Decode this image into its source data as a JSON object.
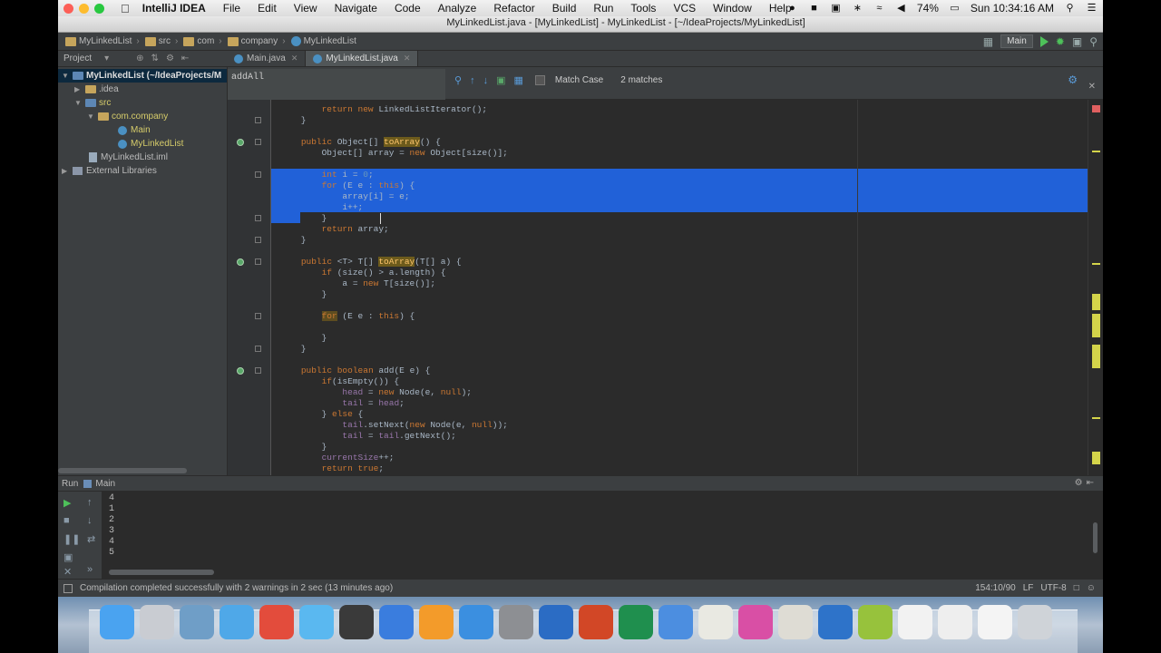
{
  "menubar": {
    "app_name": "IntelliJ IDEA",
    "items": [
      "File",
      "Edit",
      "View",
      "Navigate",
      "Code",
      "Analyze",
      "Refactor",
      "Build",
      "Run",
      "Tools",
      "VCS",
      "Window",
      "Help"
    ],
    "battery": "74%",
    "clock": "Sun 10:34:16 AM"
  },
  "window_title": "MyLinkedList.java - [MyLinkedList] - MyLinkedList - [~/IdeaProjects/MyLinkedList]",
  "breadcrumbs": [
    "MyLinkedList",
    "src",
    "com",
    "company",
    "MyLinkedList"
  ],
  "run_config": "Main",
  "project_panel": {
    "label": "Project",
    "tree": [
      {
        "label": "MyLinkedList (~/IdeaProjects/M",
        "level": 0
      },
      {
        "label": ".idea",
        "level": 1
      },
      {
        "label": "src",
        "level": 1
      },
      {
        "label": "com.company",
        "level": 2
      },
      {
        "label": "Main",
        "level": 3
      },
      {
        "label": "MyLinkedList",
        "level": 3
      },
      {
        "label": "MyLinkedList.iml",
        "level": 1
      },
      {
        "label": "External Libraries",
        "level": 0
      }
    ]
  },
  "tabs": [
    {
      "label": "Main.java",
      "active": false
    },
    {
      "label": "MyLinkedList.java",
      "active": true
    }
  ],
  "find": {
    "query": "addAll",
    "match_case_label": "Match Case",
    "matches": "2 matches"
  },
  "code": [
    "        return new LinkedListIterator();",
    "    }",
    "",
    "    public Object[] toArray() {",
    "        Object[] array = new Object[size()];",
    "",
    "        int i = 0;",
    "        for (E e : this) {",
    "            array[i] = e;",
    "            i++;",
    "        }",
    "        return array;",
    "    }",
    "",
    "    public <T> T[] toArray(T[] a) {",
    "        if (size() > a.length) {",
    "            a = new T[size()];",
    "        }",
    "",
    "        for (E e : this) {",
    "",
    "        }",
    "    }",
    "",
    "    public boolean add(E e) {",
    "        if(isEmpty()) {",
    "            head = new Node(e, null);",
    "            tail = head;",
    "        } else {",
    "            tail.setNext(new Node(e, null));",
    "            tail = tail.getNext();",
    "        }",
    "        currentSize++;",
    "        return true;"
  ],
  "run_panel": {
    "label": "Run",
    "config": "Main",
    "output": [
      "4",
      "1",
      "2",
      "3",
      "4",
      "5"
    ]
  },
  "status": {
    "message": "Compilation completed successfully with 2 warnings in 2 sec (13 minutes ago)",
    "position": "154:10/90",
    "line_sep": "LF",
    "encoding": "UTF-8"
  },
  "colors": {
    "editor_bg": "#2b2b2b",
    "selection": "#2161d8",
    "keyword": "#cc7832",
    "method": "#ffc66d"
  }
}
